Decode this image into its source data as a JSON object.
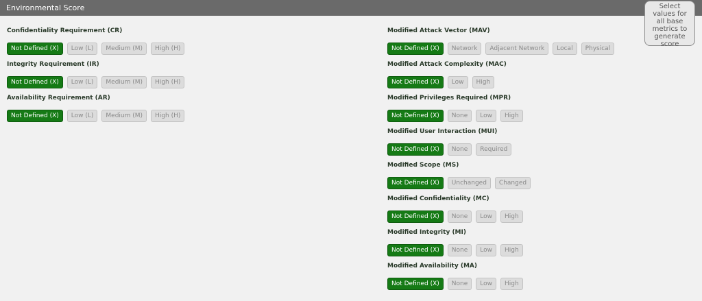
{
  "header": {
    "title": "Environmental Score"
  },
  "score_box": {
    "text": "Select values for all base metrics to generate score"
  },
  "colors": {
    "selected": "#157a15",
    "header": "#6a6a6a"
  },
  "left_metrics": [
    {
      "id": "cr",
      "label": "Confidentiality Requirement (CR)",
      "options": [
        "Not Defined (X)",
        "Low (L)",
        "Medium (M)",
        "High (H)"
      ],
      "selected": 0
    },
    {
      "id": "ir",
      "label": "Integrity Requirement (IR)",
      "options": [
        "Not Defined (X)",
        "Low (L)",
        "Medium (M)",
        "High (H)"
      ],
      "selected": 0
    },
    {
      "id": "ar",
      "label": "Availability Requirement (AR)",
      "options": [
        "Not Defined (X)",
        "Low (L)",
        "Medium (M)",
        "High (H)"
      ],
      "selected": 0
    }
  ],
  "right_metrics": [
    {
      "id": "mav",
      "label": "Modified Attack Vector (MAV)",
      "options": [
        "Not Defined (X)",
        "Network",
        "Adjacent Network",
        "Local",
        "Physical"
      ],
      "selected": 0
    },
    {
      "id": "mac",
      "label": "Modified Attack Complexity (MAC)",
      "options": [
        "Not Defined (X)",
        "Low",
        "High"
      ],
      "selected": 0
    },
    {
      "id": "mpr",
      "label": "Modified Privileges Required (MPR)",
      "options": [
        "Not Defined (X)",
        "None",
        "Low",
        "High"
      ],
      "selected": 0
    },
    {
      "id": "mui",
      "label": "Modified User Interaction (MUI)",
      "options": [
        "Not Defined (X)",
        "None",
        "Required"
      ],
      "selected": 0
    },
    {
      "id": "ms",
      "label": "Modified Scope (MS)",
      "options": [
        "Not Defined (X)",
        "Unchanged",
        "Changed"
      ],
      "selected": 0
    },
    {
      "id": "mc",
      "label": "Modified Confidentiality (MC)",
      "options": [
        "Not Defined (X)",
        "None",
        "Low",
        "High"
      ],
      "selected": 0
    },
    {
      "id": "mi",
      "label": "Modified Integrity (MI)",
      "options": [
        "Not Defined (X)",
        "None",
        "Low",
        "High"
      ],
      "selected": 0
    },
    {
      "id": "ma",
      "label": "Modified Availability (MA)",
      "options": [
        "Not Defined (X)",
        "None",
        "Low",
        "High"
      ],
      "selected": 0
    }
  ]
}
